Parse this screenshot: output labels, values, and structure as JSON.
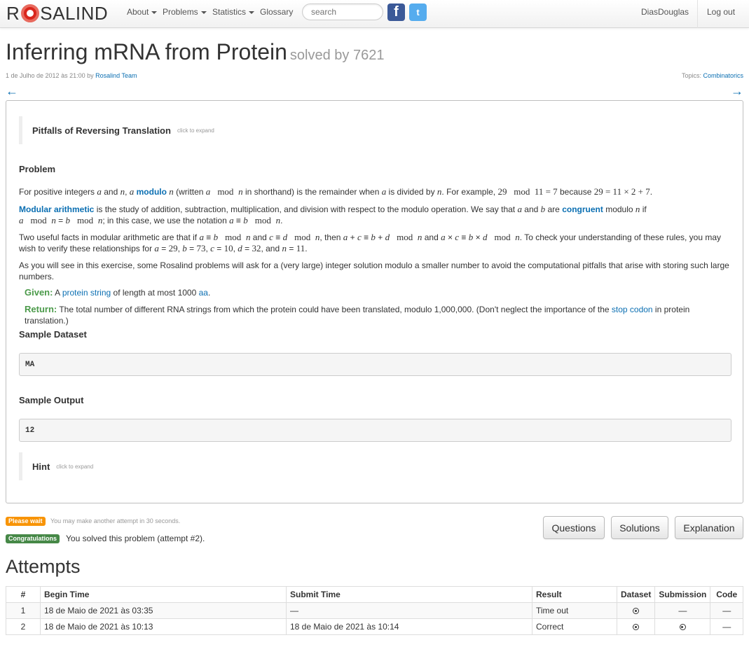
{
  "nav": {
    "brand_prefix": "R",
    "brand_suffix": "SALIND",
    "about": "About",
    "problems": "Problems",
    "statistics": "Statistics",
    "glossary": "Glossary",
    "search_placeholder": "search",
    "facebook_icon": "facebook-icon",
    "twitter_icon": "twitter-icon",
    "username": "DiasDouglas",
    "logout": "Log out"
  },
  "header": {
    "title": "Inferring mRNA from Protein",
    "solved_by": "solved by 7621",
    "date": "1 de Julho de 2012 às 21:00 by ",
    "author": "Rosalind Team",
    "topics_label": "Topics: ",
    "topics_value": "Combinatorics",
    "prev_arrow": "←",
    "next_arrow": "→"
  },
  "problem": {
    "pitfalls_title": "Pitfalls of Reversing Translation",
    "click_to_expand": "click to expand",
    "problem_heading": "Problem",
    "modulo_link": "modulo",
    "modular_arithmetic_link": "Modular arithmetic",
    "congruent_link": "congruent",
    "para3_tail": "As you will see in this exercise, some Rosalind problems will ask for a (very large) integer solution modulo a smaller number to avoid the computational pitfalls that arise with storing such large numbers.",
    "given_label": "Given:",
    "given_pre": "A ",
    "given_link": "protein string",
    "given_mid": " of length at most 1000 ",
    "given_aa": "aa",
    "return_label": "Return:",
    "return_pre": "The total number of different RNA strings from which the protein could have been translated, modulo 1,000,000. (Don't neglect the importance of the ",
    "return_link": "stop codon",
    "return_post": " in protein translation.)",
    "sample_dataset_heading": "Sample Dataset",
    "sample_dataset": "MA",
    "sample_output_heading": "Sample Output",
    "sample_output": "12",
    "hint_title": "Hint"
  },
  "status": {
    "wait_badge": "Please wait",
    "wait_text": "You may make another attempt in 30 seconds.",
    "ok_badge": "Congratulations",
    "ok_text": "You solved this problem (attempt #2)."
  },
  "buttons": {
    "questions": "Questions",
    "solutions": "Solutions",
    "explanation": "Explanation"
  },
  "attempts": {
    "heading": "Attempts",
    "columns": [
      "#",
      "Begin Time",
      "Submit Time",
      "Result",
      "Dataset",
      "Submission",
      "Code"
    ],
    "rows": [
      {
        "num": "1",
        "begin": "18 de Maio de 2021 às 03:35",
        "submit": "—",
        "result": "Time out",
        "submission": "—",
        "code": "—"
      },
      {
        "num": "2",
        "begin": "18 de Maio de 2021 às 10:13",
        "submit": "18 de Maio de 2021 às 10:14",
        "result": "Correct",
        "code": "—"
      }
    ],
    "download_icon": "download-icon"
  }
}
